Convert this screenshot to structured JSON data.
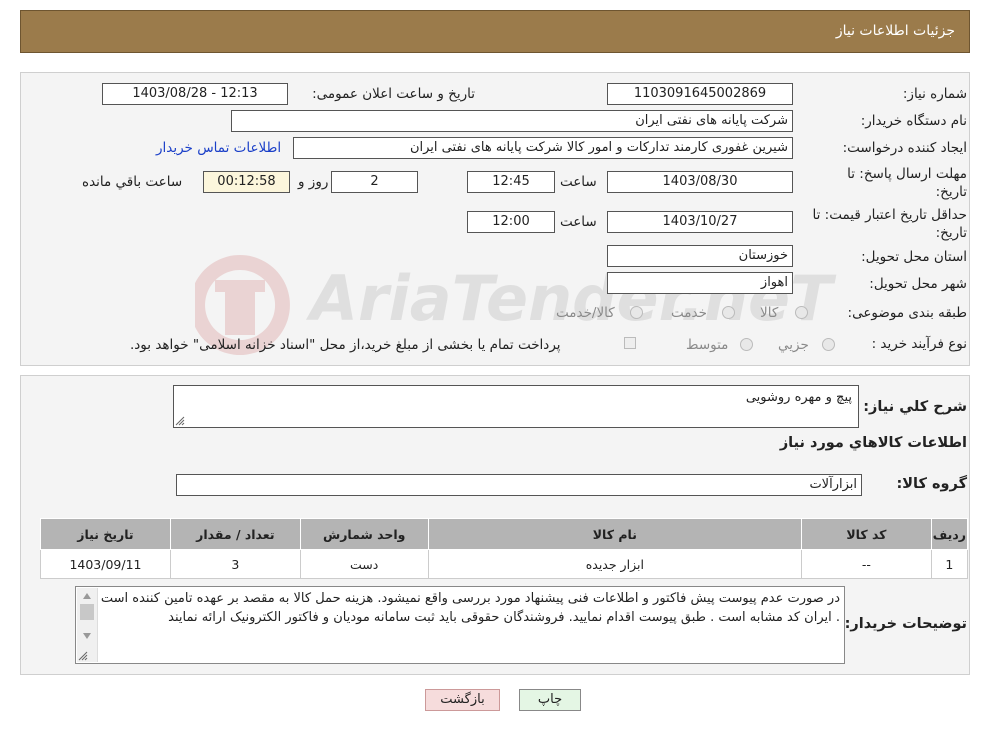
{
  "header": {
    "title": "جزئیات اطلاعات نیاز"
  },
  "fields": {
    "need_number_label": "شماره نیاز:",
    "need_number": "1103091645002869",
    "announce_label": "تاریخ و ساعت اعلان عمومی:",
    "announce_value": "1403/08/28 - 12:13",
    "buyer_org_label": "نام دستگاه خریدار:",
    "buyer_org": "شرکت پایانه های نفتی ایران",
    "creator_label": "ایجاد کننده درخواست:",
    "creator": "شیرین غفوری کارمند تدارکات و امور کالا شرکت پایانه های نفتی ایران",
    "contact_link": "اطلاعات تماس خریدار",
    "deadline_label_1": "مهلت ارسال پاسخ: تا",
    "deadline_label_2": "تاریخ:",
    "deadline_date": "1403/08/30",
    "time_word": "ساعت",
    "deadline_time": "12:45",
    "days_value": "2",
    "days_word": "روز و",
    "remaining_time": "00:12:58",
    "remaining_word": "ساعت باقي مانده",
    "validity_label_1": "حداقل تاریخ اعتبار قیمت: تا",
    "validity_label_2": "تاریخ:",
    "validity_date": "1403/10/27",
    "validity_time": "12:00",
    "province_label": "استان محل تحویل:",
    "province": "خوزستان",
    "city_label": "شهر محل تحویل:",
    "city": "اهواز",
    "category_label": "طبقه بندی موضوعی:",
    "category_options": [
      "کالا",
      "خدمت",
      "کالا/خدمت"
    ],
    "process_label": "نوع فرآیند خرید :",
    "process_options": [
      "جزیي",
      "متوسط"
    ],
    "payment_note": "پرداخت تمام یا بخشی از مبلغ خرید،از محل \"اسناد خزانه اسلامی\" خواهد بود."
  },
  "summary": {
    "label": "شرح کلي نياز:",
    "value": "پیچ و مهره روشویی",
    "items_heading": "اطلاعات کالاهاي مورد نياز",
    "group_label": "گروه کالا:",
    "group_value": "ابزارآلات"
  },
  "table": {
    "headers": [
      "رديف",
      "کد کالا",
      "نام کالا",
      "واحد شمارش",
      "تعداد / مقدار",
      "تاریخ نیاز"
    ],
    "rows": [
      [
        "1",
        "--",
        "ابزار جدیده",
        "دست",
        "3",
        "1403/09/11"
      ]
    ]
  },
  "notes": {
    "label": "توضیحات خریدار:",
    "text": "در صورت عدم پیوست پیش فاکتور و اطلاعات فنی پیشنهاد مورد بررسی واقع نمیشود. هزینه حمل کالا به مقصد بر عهده تامین کننده است . ایران کد مشابه است . طبق پیوست اقدام نمایید. فروشندگان حقوقی باید ثبت سامانه مودیان و فاکتور الکترونیک ارائه نمایند"
  },
  "buttons": {
    "print": "چاپ",
    "back": "بازگشت"
  },
  "watermark": {
    "text": "AriaTender.neT"
  },
  "colors": {
    "header_bg": "#9b7b4b",
    "link": "#1a3fc8",
    "back_btn_bg": "#f6dcdc",
    "print_btn_bg": "#e4f6e4",
    "table_header": "#b4b4b4"
  }
}
